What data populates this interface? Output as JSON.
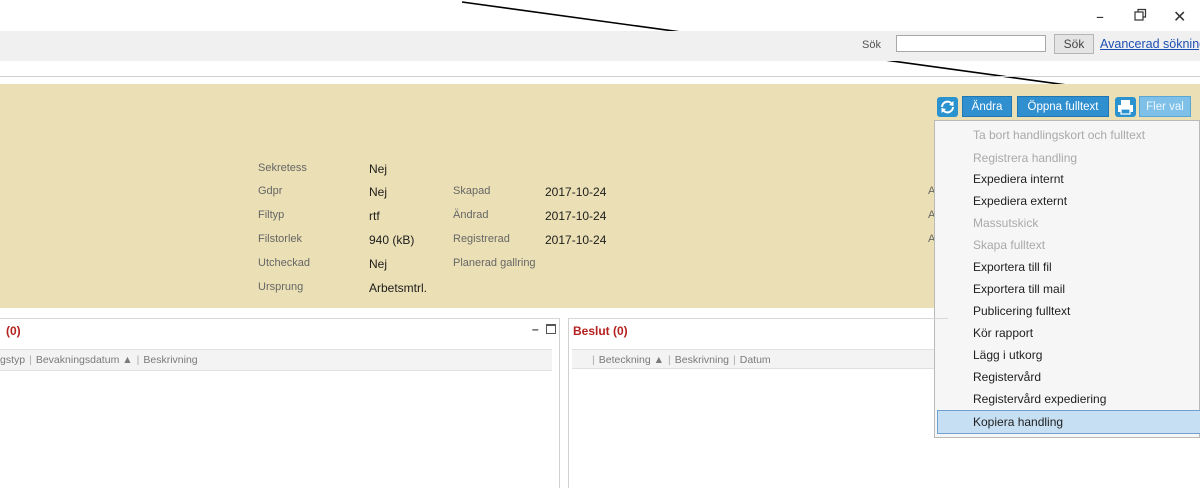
{
  "window": {
    "minimize_icon": "minimize-icon",
    "restore_icon": "restore-icon",
    "close_icon": "close-icon"
  },
  "search": {
    "label": "Sök",
    "button": "Sök",
    "advanced_link": "Avancerad sökning",
    "value": ""
  },
  "toolbar": {
    "andra": "Ändra",
    "oppna_fulltext": "Öppna fulltext",
    "fler_val": "Fler val"
  },
  "metadata": {
    "col1": [
      {
        "label": "Sekretess",
        "value": "Nej"
      },
      {
        "label": "Gdpr",
        "value": "Nej"
      },
      {
        "label": "Filtyp",
        "value": "rtf"
      },
      {
        "label": "Filstorlek",
        "value": "940 (kB)"
      },
      {
        "label": "Utcheckad",
        "value": "Nej"
      },
      {
        "label": "Ursprung",
        "value": "Arbetsmtrl."
      }
    ],
    "col2": [
      {
        "label": "Skapad",
        "value": "2017-10-24"
      },
      {
        "label": "Ändrad",
        "value": "2017-10-24"
      },
      {
        "label": "Registrerad",
        "value": "2017-10-24"
      },
      {
        "label": "Planerad gallring",
        "value": ""
      }
    ],
    "cut_label": "A"
  },
  "menu": {
    "items": [
      {
        "label": "Ta bort handlingskort och fulltext",
        "enabled": false
      },
      {
        "label": "Registrera handling",
        "enabled": false
      },
      {
        "label": "Expediera internt",
        "enabled": true
      },
      {
        "label": "Expediera externt",
        "enabled": true
      },
      {
        "label": "Massutskick",
        "enabled": false
      },
      {
        "label": "Skapa fulltext",
        "enabled": false
      },
      {
        "label": "Exportera till fil",
        "enabled": true
      },
      {
        "label": "Exportera till mail",
        "enabled": true
      },
      {
        "label": "Publicering fulltext",
        "enabled": true
      },
      {
        "label": "Kör rapport",
        "enabled": true
      },
      {
        "label": "Lägg i utkorg",
        "enabled": true
      },
      {
        "label": "Registervård",
        "enabled": true
      },
      {
        "label": "Registervård expediering",
        "enabled": true
      },
      {
        "label": "Kopiera handling",
        "enabled": true,
        "highlighted": true
      }
    ]
  },
  "left_panel": {
    "title": "(0)",
    "columns": [
      "gstyp",
      "Bevakningsdatum ▲",
      "Beskrivning"
    ],
    "minimize": "–"
  },
  "right_panel": {
    "title": "Beslut (0)",
    "columns": [
      "Beteckning ▲",
      "Beskrivning",
      "Datum"
    ]
  },
  "colors": {
    "panel_bg": "#ebe0b5",
    "accent_blue": "#2f8fcf",
    "title_red": "#b52020"
  }
}
